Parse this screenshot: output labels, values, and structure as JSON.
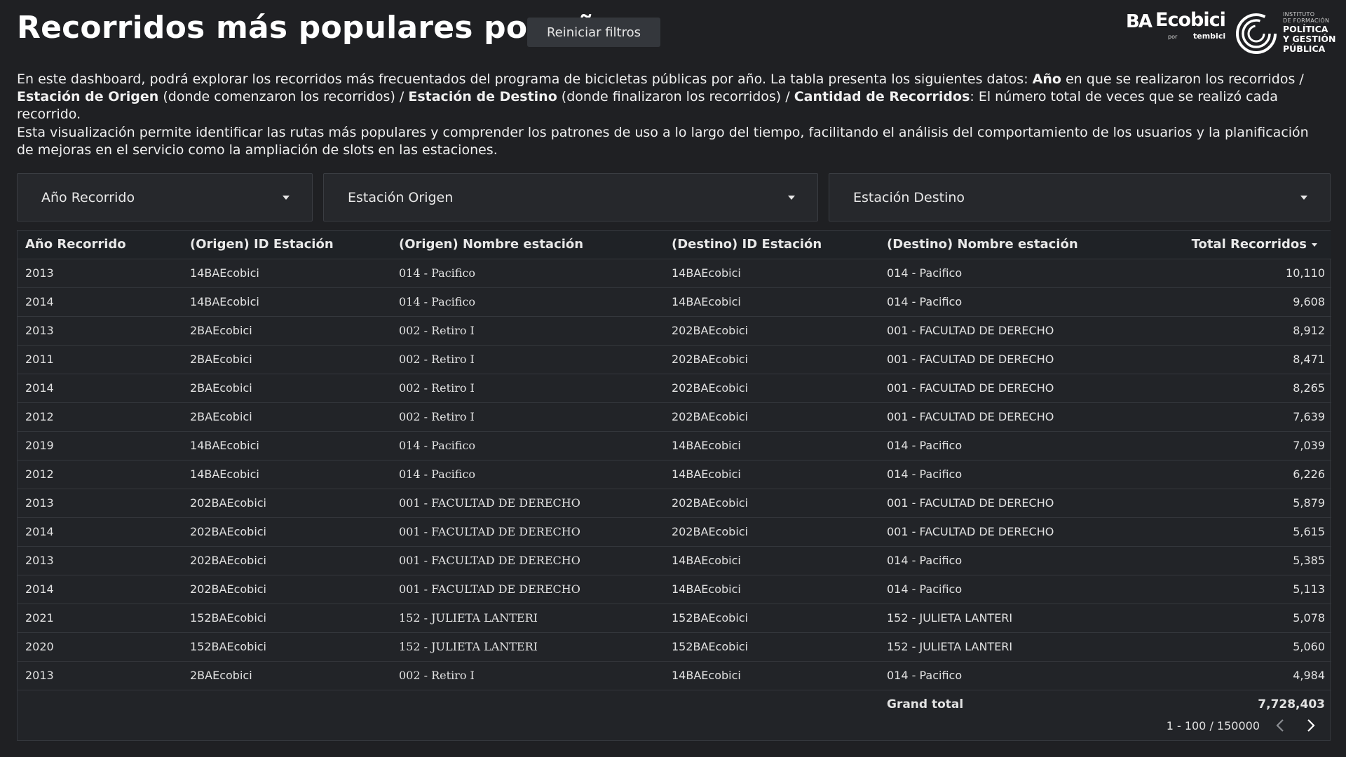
{
  "header": {
    "title": "Recorridos más populares por año",
    "reset_label": "Reiniciar filtros"
  },
  "logos": {
    "ecobici": {
      "ba": "BA",
      "name": "Ecobici",
      "por": "por",
      "tembici": "tembici"
    },
    "instituto": {
      "small1": "INSTITUTO",
      "small2": "DE FORMACIÓN",
      "big1": "POLÍTICA",
      "big2": "Y GESTIÓN",
      "big3": "PÚBLICA"
    }
  },
  "description": {
    "p1": [
      {
        "t": "En este dashboard, podrá explorar los recorridos más frecuentados del programa de bicicletas públicas por año. La tabla presenta los siguientes datos: ",
        "b": false
      },
      {
        "t": "Año",
        "b": true
      },
      {
        "t": " en que se realizaron los recorridos / ",
        "b": false
      },
      {
        "t": "Estación de Origen",
        "b": true
      },
      {
        "t": " (donde comenzaron los recorridos) / ",
        "b": false
      },
      {
        "t": "Estación de Destino",
        "b": true
      },
      {
        "t": " (donde finalizaron los recorridos) / ",
        "b": false
      },
      {
        "t": "Cantidad de Recorridos",
        "b": true
      },
      {
        "t": ": El número total de veces que se realizó cada recorrido.",
        "b": false
      }
    ],
    "p2": "Esta visualización permite identificar las rutas más populares y comprender los patrones de uso a lo largo del tiempo, facilitando el análisis del comportamiento de los usuarios y la planificación de mejoras en el servicio como la ampliación de slots en las estaciones."
  },
  "filters": {
    "year": "Año Recorrido",
    "origin": "Estación Origen",
    "destination": "Estación Destino"
  },
  "table": {
    "headers": [
      "Año Recorrido",
      "(Origen) ID Estación",
      "(Origen) Nombre estación",
      "(Destino) ID Estación",
      "(Destino) Nombre estación",
      "Total Recorridos"
    ],
    "rows": [
      [
        "2013",
        "14BAEcobici",
        "014 - Pacifico",
        "14BAEcobici",
        "014 - Pacifico",
        "10,110"
      ],
      [
        "2014",
        "14BAEcobici",
        "014 - Pacifico",
        "14BAEcobici",
        "014 - Pacifico",
        "9,608"
      ],
      [
        "2013",
        "2BAEcobici",
        "002 - Retiro I",
        "202BAEcobici",
        "001 - FACULTAD DE DERECHO",
        "8,912"
      ],
      [
        "2011",
        "2BAEcobici",
        "002 - Retiro I",
        "202BAEcobici",
        "001 - FACULTAD DE DERECHO",
        "8,471"
      ],
      [
        "2014",
        "2BAEcobici",
        "002 - Retiro I",
        "202BAEcobici",
        "001 - FACULTAD DE DERECHO",
        "8,265"
      ],
      [
        "2012",
        "2BAEcobici",
        "002 - Retiro I",
        "202BAEcobici",
        "001 - FACULTAD DE DERECHO",
        "7,639"
      ],
      [
        "2019",
        "14BAEcobici",
        "014 - Pacifico",
        "14BAEcobici",
        "014 - Pacifico",
        "7,039"
      ],
      [
        "2012",
        "14BAEcobici",
        "014 - Pacifico",
        "14BAEcobici",
        "014 - Pacifico",
        "6,226"
      ],
      [
        "2013",
        "202BAEcobici",
        "001 - FACULTAD DE DERECHO",
        "202BAEcobici",
        "001 - FACULTAD DE DERECHO",
        "5,879"
      ],
      [
        "2014",
        "202BAEcobici",
        "001 - FACULTAD DE DERECHO",
        "202BAEcobici",
        "001 - FACULTAD DE DERECHO",
        "5,615"
      ],
      [
        "2013",
        "202BAEcobici",
        "001 - FACULTAD DE DERECHO",
        "14BAEcobici",
        "014 - Pacifico",
        "5,385"
      ],
      [
        "2014",
        "202BAEcobici",
        "001 - FACULTAD DE DERECHO",
        "14BAEcobici",
        "014 - Pacifico",
        "5,113"
      ],
      [
        "2021",
        "152BAEcobici",
        "152 - JULIETA LANTERI",
        "152BAEcobici",
        "152 - JULIETA LANTERI",
        "5,078"
      ],
      [
        "2020",
        "152BAEcobici",
        "152 - JULIETA LANTERI",
        "152BAEcobici",
        "152 - JULIETA LANTERI",
        "5,060"
      ],
      [
        "2013",
        "2BAEcobici",
        "002 - Retiro I",
        "14BAEcobici",
        "014 - Pacifico",
        "4,984"
      ]
    ],
    "grand_total_label": "Grand total",
    "grand_total_value": "7,728,403"
  },
  "pager": {
    "range": "1 - 100 / 150000"
  }
}
